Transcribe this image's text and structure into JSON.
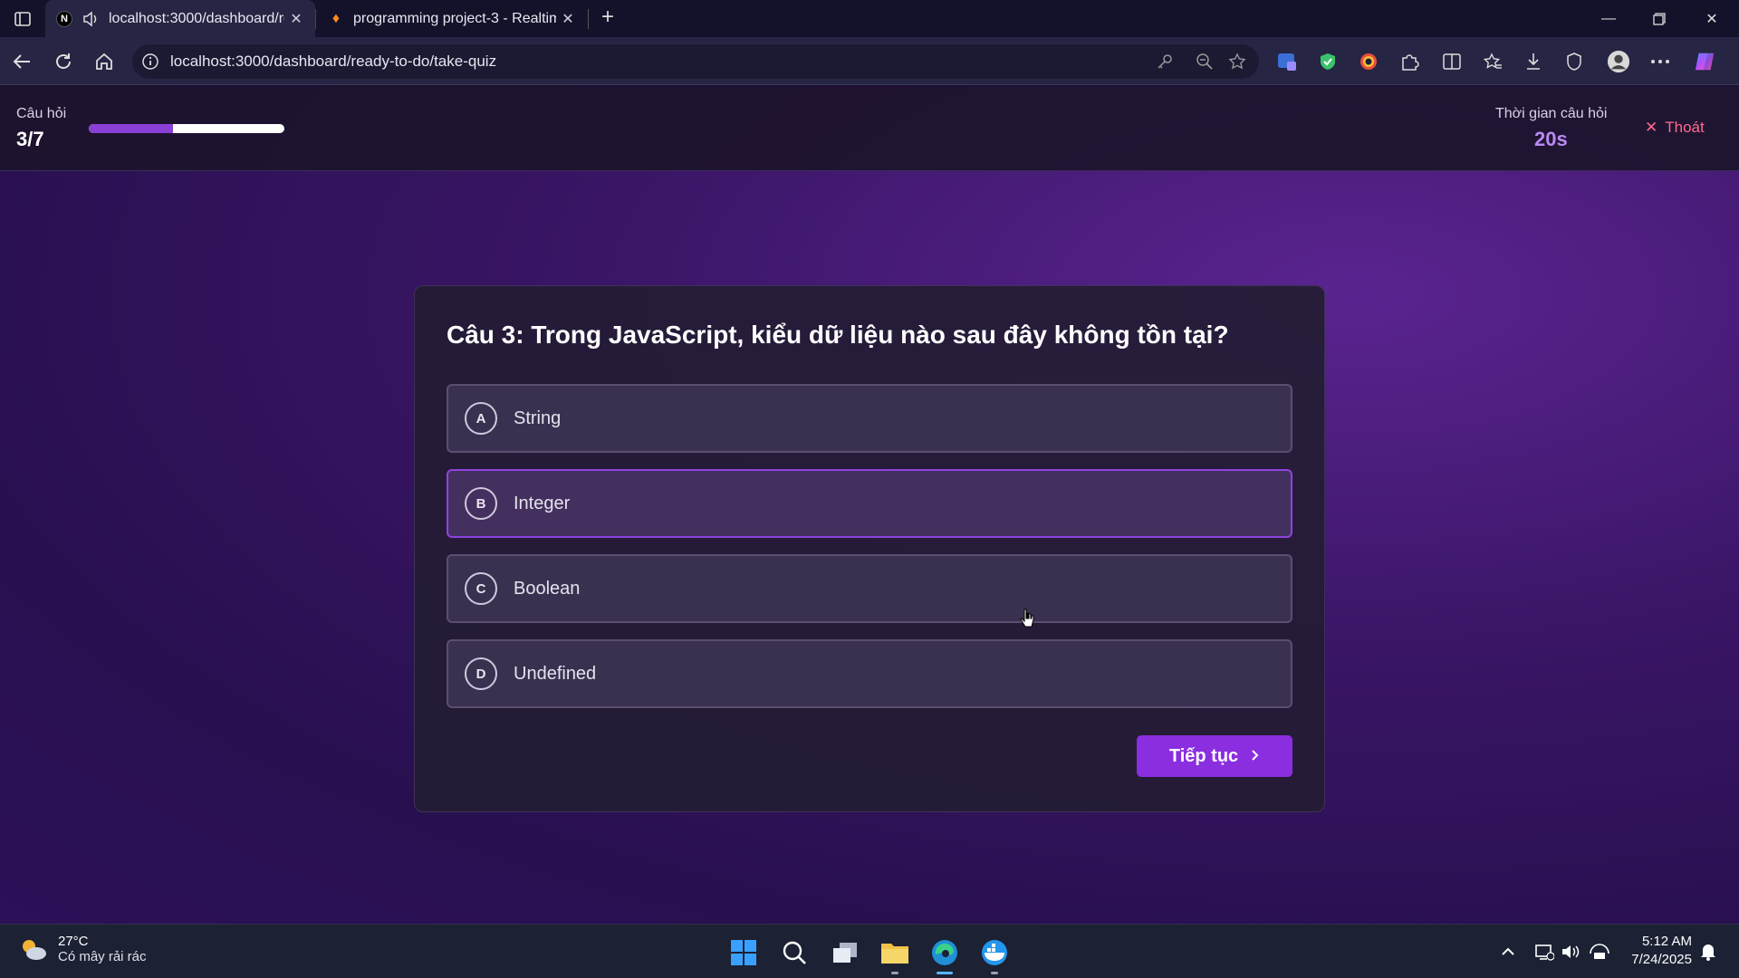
{
  "browser": {
    "tabs": [
      {
        "title": "localhost:3000/dashboard/re",
        "active": true
      },
      {
        "title": "programming project-3 - Realtim",
        "active": false
      }
    ],
    "url": "localhost:3000/dashboard/ready-to-do/take-quiz"
  },
  "quiz": {
    "question_label": "Câu hỏi",
    "question_count": "3/7",
    "progress_fraction": 0.43,
    "timer_label": "Thời gian câu hỏi",
    "timer_value": "20s",
    "exit_label": "Thoát",
    "question": "Câu 3: Trong JavaScript, kiểu dữ liệu nào sau đây không tồn tại?",
    "options": [
      {
        "letter": "A",
        "text": "String"
      },
      {
        "letter": "B",
        "text": "Integer"
      },
      {
        "letter": "C",
        "text": "Boolean"
      },
      {
        "letter": "D",
        "text": "Undefined"
      }
    ],
    "next_label": "Tiếp tục"
  },
  "taskbar": {
    "weather_temp": "27°C",
    "weather_desc": "Có mây rải rác",
    "time": "5:12 AM",
    "date": "7/24/2025"
  },
  "colors": {
    "accent": "#8a2ee0",
    "timer": "#b98af0",
    "exit": "#ff6b8a",
    "progress": "#8a3fd6"
  }
}
